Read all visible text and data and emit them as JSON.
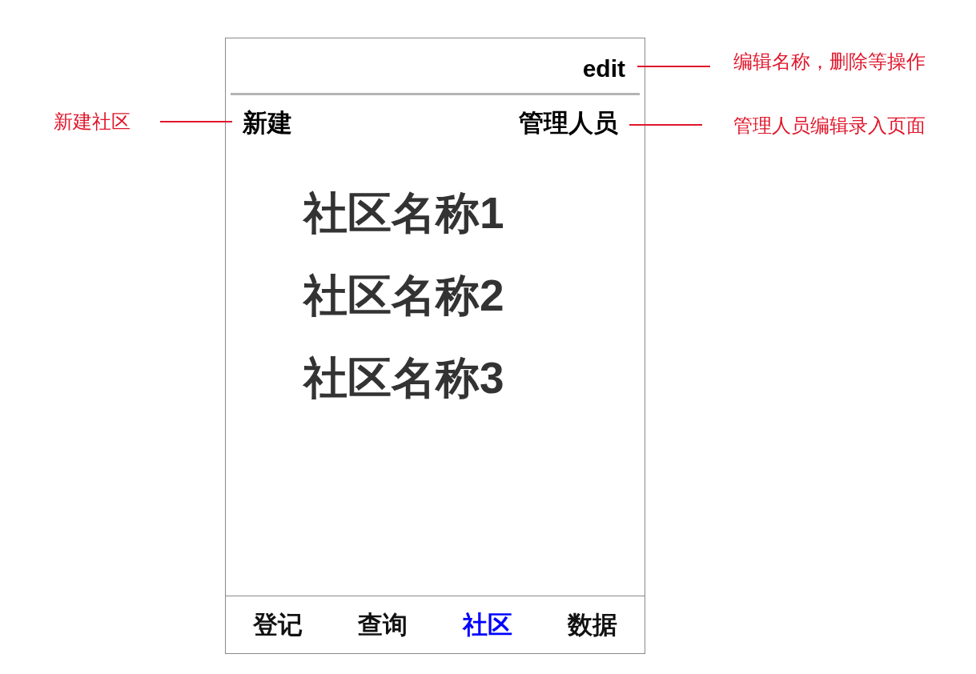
{
  "top_bar": {
    "edit": {
      "label": "edit",
      "annotation": "编辑名称，删除等操作"
    }
  },
  "action_bar": {
    "new": {
      "label": "新建",
      "annotation": "新建社区"
    },
    "manage": {
      "label": "管理人员",
      "annotation": "管理人员编辑录入页面"
    }
  },
  "communities": [
    "社区名称1",
    "社区名称2",
    "社区名称3"
  ],
  "tab_bar": [
    {
      "label": "登记",
      "selected": false
    },
    {
      "label": "查询",
      "selected": false
    },
    {
      "label": "社区",
      "selected": true
    },
    {
      "label": "数据",
      "selected": false
    }
  ]
}
